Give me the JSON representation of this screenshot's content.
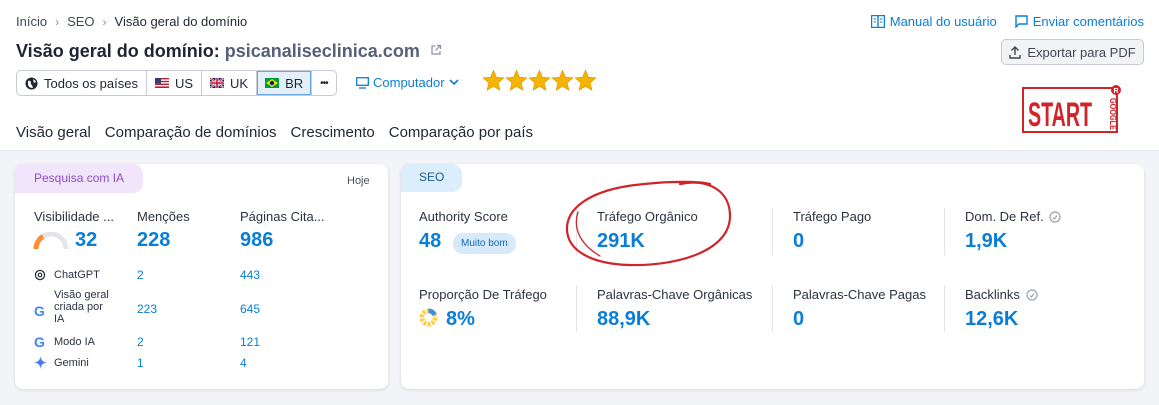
{
  "breadcrumb": [
    "Início",
    "SEO",
    "Visão geral do domínio"
  ],
  "header": {
    "manual_label": "Manual do usuário",
    "feedback_label": "Enviar comentários",
    "title_prefix": "Visão geral do domínio:",
    "domain": "psicanaliseclinica.com",
    "export_label": "Exportar para PDF"
  },
  "filters": {
    "all_countries": "Todos os países",
    "countries": [
      "US",
      "UK",
      "BR"
    ],
    "selected_country": "BR",
    "more": "•••",
    "device": "Computador"
  },
  "rating": {
    "stars": 5,
    "max": 5
  },
  "logo": {
    "text": "START",
    "side_text": "GOOGLE",
    "badge": "R"
  },
  "tabs": [
    "Visão geral",
    "Comparação de domínios",
    "Crescimento",
    "Comparação por país"
  ],
  "ia": {
    "pill": "Pesquisa com IA",
    "date": "Hoje",
    "columns": [
      {
        "label": "Visibilidade ...",
        "value": "32"
      },
      {
        "label": "Menções",
        "value": "228"
      },
      {
        "label": "Páginas Cita...",
        "value": "986"
      }
    ],
    "visibility_gauge": 0.32,
    "rows": [
      {
        "name": "ChatGPT",
        "icon": "chatgpt-icon",
        "mentions": "2",
        "pages": "443"
      },
      {
        "name": "Visão geral criada por IA",
        "icon": "google-icon",
        "mentions": "223",
        "pages": "645"
      },
      {
        "name": "Modo IA",
        "icon": "google-icon",
        "mentions": "2",
        "pages": "121"
      },
      {
        "name": "Gemini",
        "icon": "gemini-icon",
        "mentions": "1",
        "pages": "4"
      }
    ]
  },
  "seo": {
    "pill": "SEO",
    "authority": {
      "label": "Authority Score",
      "value": "48",
      "badge": "Muito bom"
    },
    "organic_traffic": {
      "label": "Tráfego Orgânico",
      "value": "291K"
    },
    "paid_traffic": {
      "label": "Tráfego Pago",
      "value": "0"
    },
    "ref_domains": {
      "label": "Dom. De Ref.",
      "value": "1,9K"
    },
    "traffic_share": {
      "label": "Proporção De Tráfego",
      "value": "8%"
    },
    "organic_keywords": {
      "label": "Palavras-Chave Orgânicas",
      "value": "88,9K"
    },
    "paid_keywords": {
      "label": "Palavras-Chave Pagas",
      "value": "0"
    },
    "backlinks": {
      "label": "Backlinks",
      "value": "12,6K"
    }
  },
  "colors": {
    "accent": "#0a7ed6",
    "star": "#f5b400",
    "annotation": "#d2232a",
    "ia_pill": "#f1e5fb",
    "seo_pill": "#dbeefb"
  }
}
